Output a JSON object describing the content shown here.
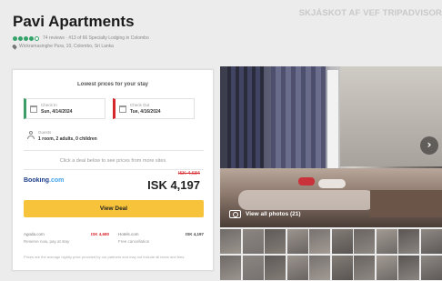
{
  "credit": "SKJÁSKOT AF VEF TRIPADVISOR",
  "header": {
    "title": "Pavi Apartments",
    "rating_bubbles": 4,
    "review_line": "74 reviews  ·  #13 of 66 Specialty Lodging in Colombo",
    "address": "Wickramasinghe Pura, 10, Colombo, Sri Lanka"
  },
  "booking": {
    "heading": "Lowest prices for your stay",
    "check_in_label": "Check In",
    "check_in_value": "Sun, 4/14/2024",
    "check_out_label": "Check Out",
    "check_out_value": "Tue, 4/16/2024",
    "guests_label": "Guests",
    "guests_value": "1 room, 2 adults, 0 children",
    "note": "Click a deal below to see prices from more sites",
    "provider_name": "Booking",
    "provider_suffix": ".com",
    "old_price": "ISK 4,684",
    "price": "ISK 4,197",
    "cta_label": "View Deal",
    "offers": [
      {
        "name": "Agoda.com",
        "sub": "Reserve now, pay at stay",
        "amount": "ISK 4,680",
        "red": true
      },
      {
        "name": "Hotels.com",
        "sub": "Free cancellation",
        "amount": "ISK 4,197",
        "red": false
      }
    ],
    "disclaimer": "Prices are the average nightly price provided by our partners and may not include all taxes and fees."
  },
  "gallery": {
    "view_all_label": "View all photos (21)",
    "thumb_count": 20
  },
  "colors": {
    "accent_green": "#34a36b",
    "check_in": "#3c9d69",
    "check_out": "#d6262d",
    "cta_yellow": "#f6c33a",
    "booking_blue": "#1c3e8c"
  }
}
